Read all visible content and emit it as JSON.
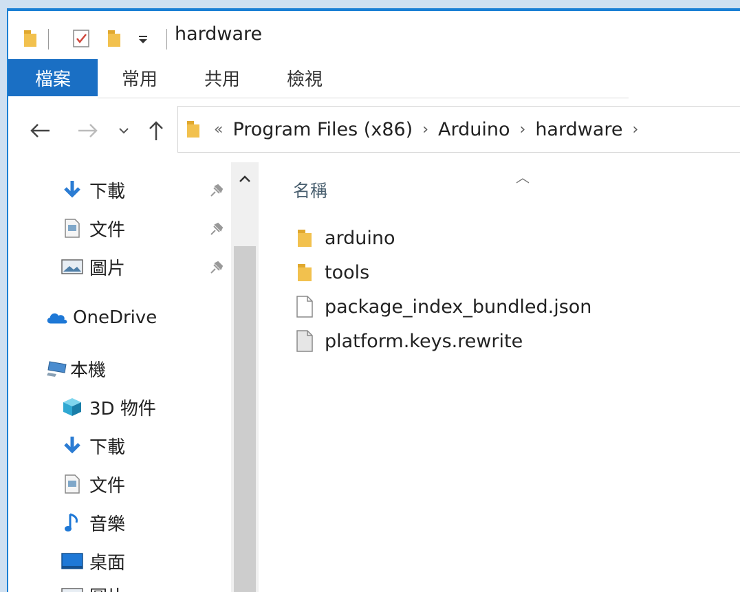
{
  "window": {
    "title": "hardware"
  },
  "ribbon": {
    "tabs": [
      "檔案",
      "常用",
      "共用",
      "檢視"
    ]
  },
  "address": {
    "overflow": "«",
    "crumbs": [
      "Program Files (x86)",
      "Arduino",
      "hardware"
    ]
  },
  "sidebar": {
    "quick_access": [
      {
        "label": "下載",
        "icon": "download-icon",
        "pinned": true
      },
      {
        "label": "文件",
        "icon": "document-icon",
        "pinned": true
      },
      {
        "label": "圖片",
        "icon": "pictures-icon",
        "pinned": true
      }
    ],
    "onedrive": {
      "label": "OneDrive",
      "icon": "cloud-icon"
    },
    "this_pc": {
      "label": "本機",
      "icon": "computer-icon"
    },
    "pc_items": [
      {
        "label": "3D 物件",
        "icon": "3d-objects-icon"
      },
      {
        "label": "下載",
        "icon": "download-icon"
      },
      {
        "label": "文件",
        "icon": "document-icon"
      },
      {
        "label": "音樂",
        "icon": "music-icon"
      },
      {
        "label": "桌面",
        "icon": "desktop-icon"
      },
      {
        "label": "圖片",
        "icon": "pictures-icon"
      }
    ]
  },
  "content": {
    "column_header": "名稱",
    "files": [
      {
        "name": "arduino",
        "type": "folder"
      },
      {
        "name": "tools",
        "type": "folder"
      },
      {
        "name": "package_index_bundled.json",
        "type": "file"
      },
      {
        "name": "platform.keys.rewrite",
        "type": "file"
      }
    ]
  },
  "colors": {
    "accent": "#1a6fc4",
    "folder": "#f2c14e",
    "border": "#1a7fd4"
  }
}
